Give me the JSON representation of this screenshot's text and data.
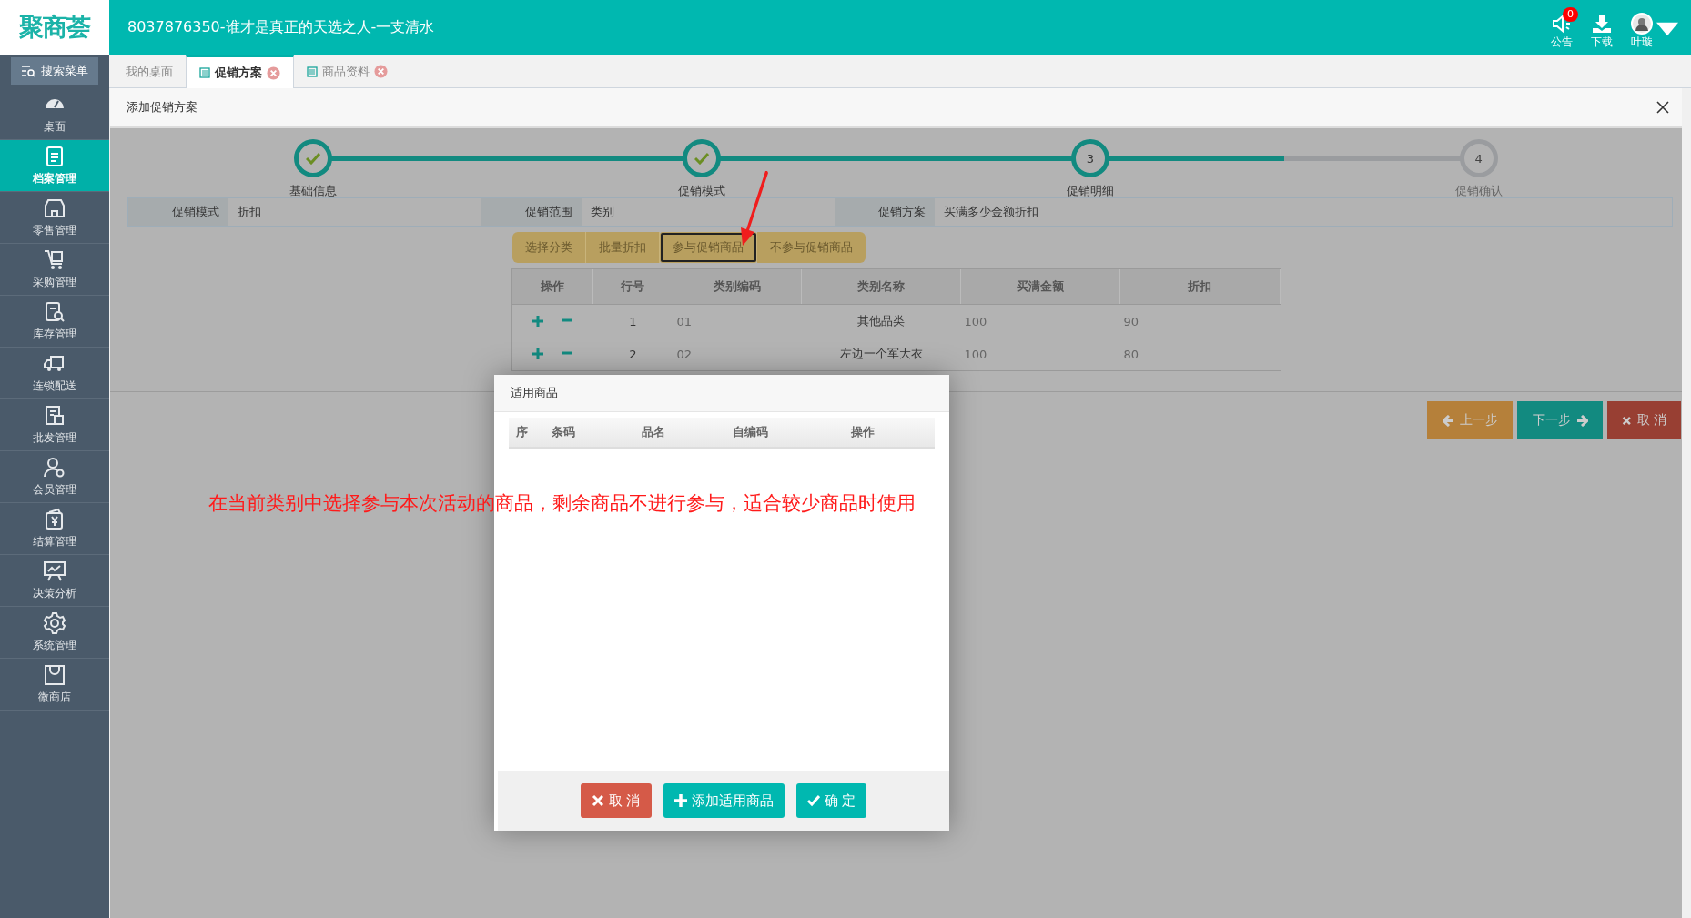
{
  "header": {
    "logo": "聚商荟",
    "title": "8037876350-谁才是真正的天选之人-一支清水",
    "actions": [
      {
        "kind": "notice",
        "label": "公告",
        "badge": "0"
      },
      {
        "kind": "download",
        "label": "下载"
      },
      {
        "kind": "user",
        "label": "叶璇"
      }
    ]
  },
  "sidebar": {
    "search": "搜索菜单",
    "items": [
      {
        "kind": "dashboard",
        "label": "桌面",
        "selected": false
      },
      {
        "kind": "archive",
        "label": "档案管理",
        "selected": true
      },
      {
        "kind": "store",
        "label": "零售管理",
        "selected": false
      },
      {
        "kind": "cart",
        "label": "采购管理",
        "selected": false
      },
      {
        "kind": "inventory",
        "label": "库存管理",
        "selected": false
      },
      {
        "kind": "truck",
        "label": "连锁配送",
        "selected": false
      },
      {
        "kind": "wholesale",
        "label": "批发管理",
        "selected": false
      },
      {
        "kind": "member",
        "label": "会员管理",
        "selected": false
      },
      {
        "kind": "wallet",
        "label": "结算管理",
        "selected": false
      },
      {
        "kind": "chart",
        "label": "决策分析",
        "selected": false
      },
      {
        "kind": "gear",
        "label": "系统管理",
        "selected": false
      },
      {
        "kind": "bag",
        "label": "微商店",
        "selected": false
      }
    ]
  },
  "tabs": [
    {
      "label": "我的桌面",
      "selected": false,
      "closable": false
    },
    {
      "label": "促销方案",
      "selected": true,
      "closable": true
    },
    {
      "label": "商品资料",
      "selected": false,
      "closable": true
    }
  ],
  "panel": {
    "title": "添加促销方案",
    "steps": [
      {
        "label": "基础信息",
        "done": true
      },
      {
        "label": "促销模式",
        "done": true
      },
      {
        "label": "促销明细",
        "number": "3",
        "done": false
      },
      {
        "label": "促销确认",
        "number": "4",
        "done": false
      }
    ],
    "fields": [
      {
        "label": "促销模式",
        "value": "折扣"
      },
      {
        "label": "促销范围",
        "value": "类别"
      },
      {
        "label": "促销方案",
        "value": "买满多少金额折扣"
      }
    ],
    "subtabs": [
      {
        "label": "选择分类",
        "selected": false
      },
      {
        "label": "批量折扣",
        "selected": false
      },
      {
        "label": "参与促销商品",
        "selected": true
      },
      {
        "label": "不参与促销商品",
        "selected": false
      }
    ],
    "table": {
      "columns": [
        "操作",
        "行号",
        "类别编码",
        "类别名称",
        "买满金额",
        "折扣"
      ],
      "rows": [
        {
          "cells": [
            "",
            "1",
            "01",
            "其他品类",
            "100",
            "90"
          ]
        },
        {
          "cells": [
            "",
            "2",
            "02",
            "左边一个军大衣",
            "100",
            "80"
          ]
        }
      ]
    },
    "buttons": [
      {
        "kind": "prev",
        "label": "上一步"
      },
      {
        "kind": "next",
        "label": "下一步"
      },
      {
        "kind": "cancel",
        "label": "取 消"
      }
    ]
  },
  "dialog": {
    "title": "适用商品",
    "columns": [
      "序",
      "条码",
      "品名",
      "自编码",
      "操作"
    ],
    "buttons": [
      {
        "kind": "cancel",
        "label": "取 消"
      },
      {
        "kind": "add",
        "label": "添加适用商品"
      },
      {
        "kind": "ok",
        "label": "确 定"
      }
    ]
  },
  "annotation": "在当前类别中选择参与本次活动的商品，剩余商品不进行参与，适合较少商品时使用"
}
